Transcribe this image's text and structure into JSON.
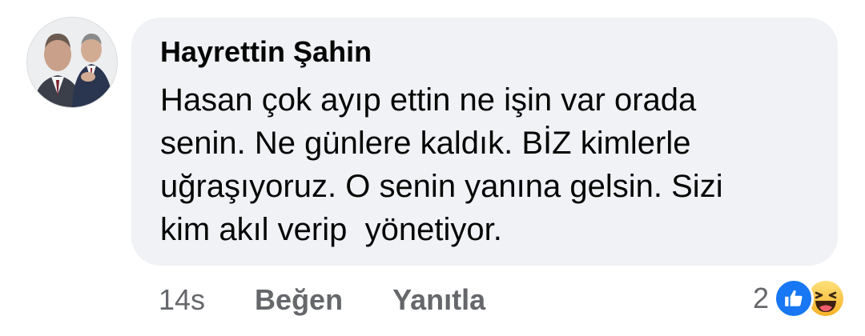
{
  "comment": {
    "author": "Hayrettin Şahin",
    "text": "Hasan çok ayıp ettin ne işin var orada\nsenin. Ne günlere kaldık. BİZ kimlerle\nuğraşıyoruz. O senin yanına gelsin. Sizi\nkim akıl verip  yönetiyor.",
    "time": "14s",
    "like_label": "Beğen",
    "reply_label": "Yanıtla",
    "reaction_count": "2",
    "reaction_icons": [
      "like-icon",
      "haha-icon"
    ]
  },
  "colors": {
    "bubble": "#f0f2f5",
    "text": "#050505",
    "meta": "#65676b",
    "like_blue": "#1877f2",
    "haha_yellow": "#f7b125"
  }
}
